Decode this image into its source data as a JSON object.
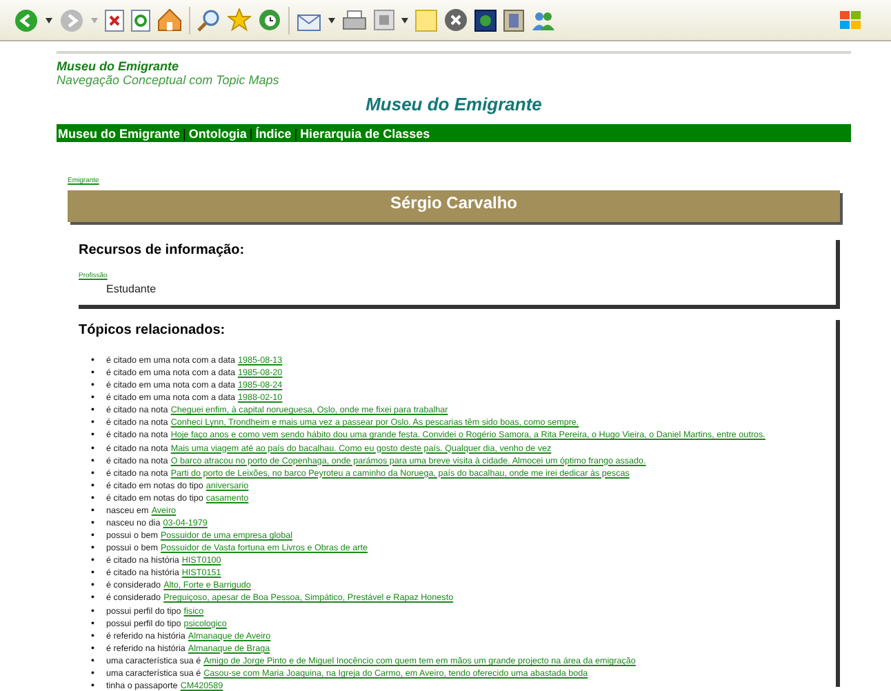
{
  "site": {
    "title": "Museu do Emigrante",
    "subtitle": "Navegação Conceptual com Topic Maps"
  },
  "page_title": "Museu do Emigrante",
  "nav": {
    "separator": "|",
    "items": [
      "Museu do Emigrante",
      "Ontologia",
      "Índice",
      "Hierarquia de Classes"
    ]
  },
  "breadcrumb": "Emigrante",
  "topic": {
    "name": "Sérgio Carvalho"
  },
  "resources": {
    "heading": "Recursos de informação:",
    "type": "Profissão",
    "value": "Estudante"
  },
  "related": {
    "heading": "Tópicos relacionados:",
    "bullet": "•",
    "items": [
      {
        "text": "é citado em uma nota com a data",
        "link": "1985-08-13"
      },
      {
        "text": "é citado em uma nota com a data",
        "link": "1985-08-20"
      },
      {
        "text": "é citado em uma nota com a data",
        "link": "1985-08-24"
      },
      {
        "text": "é citado em uma nota com a data",
        "link": "1988-02-10"
      },
      {
        "text": "é citado na nota",
        "link": "Cheguei enfim, à capital norueguesa, Oslo, onde me fixei para trabalhar"
      },
      {
        "text": "é citado na nota",
        "link": "Conheci Lynn, Trondheim e mais uma vez a passear por Oslo. As pescarias têm sido boas, como sempre."
      },
      {
        "text": "é citado na nota",
        "link": "Hoje faço anos e como vem sendo hábito dou uma grande festa. Convidei o Rogério Samora, a Rita Pereira, o Hugo Vieira, o Daniel Martins, entre outros."
      },
      {
        "text": "é citado na nota",
        "link": "Mais uma viagem até ao país do bacalhau. Como eu gosto deste país. Qualquer dia, venho de vez"
      },
      {
        "text": "é citado na nota",
        "link": "O barco atracou no porto de Copenhaga, onde parámos para uma breve visita à cidade. Almocei um óptimo frango assado."
      },
      {
        "text": "é citado na nota",
        "link": "Parti do porto de Leixões, no barco Peyroteu a caminho da Noruega, país do bacalhau, onde me irei dedicar às pescas"
      },
      {
        "text": "é citado em notas do tipo",
        "link": "aniversario"
      },
      {
        "text": "é citado em notas do tipo",
        "link": "casamento"
      },
      {
        "text": "nasceu em",
        "link": "Aveiro"
      },
      {
        "text": "nasceu no dia",
        "link": "03-04-1979"
      },
      {
        "text": "possui o bem",
        "link": "Possuidor de uma empresa global"
      },
      {
        "text": "possui o bem",
        "link": "Possuidor de Vasta fortuna em Livros e Obras de arte"
      },
      {
        "text": "é citado na história",
        "link": "HIST0100"
      },
      {
        "text": "é citado na história",
        "link": "HIST0151"
      },
      {
        "text": "é considerado",
        "link": "Alto, Forte e Barrigudo"
      },
      {
        "text": "é considerado",
        "link": "Preguiçoso, apesar de Boa Pessoa, Simpático, Prestável e Rapaz Honesto"
      },
      {
        "text": "possui perfil do tipo",
        "link": "fisico"
      },
      {
        "text": "possui perfil do tipo",
        "link": "psicologico"
      },
      {
        "text": "é referido na história",
        "link": "Almanaque de Aveiro"
      },
      {
        "text": "é referido na história",
        "link": "Almanaque de Braga"
      },
      {
        "text": "uma característica sua é",
        "link": "Amigo de Jorge Pinto e de Miguel Inocêncio com quem tem em mãos um grande projecto na área da emigração"
      },
      {
        "text": "uma característica sua é",
        "link": "Casou-se com Maria Joaquina, na Igreja do Carmo, em Aveiro, tendo oferecido uma abastada boda"
      },
      {
        "text": "tinha o passaporte",
        "link": "CM420589"
      }
    ]
  }
}
